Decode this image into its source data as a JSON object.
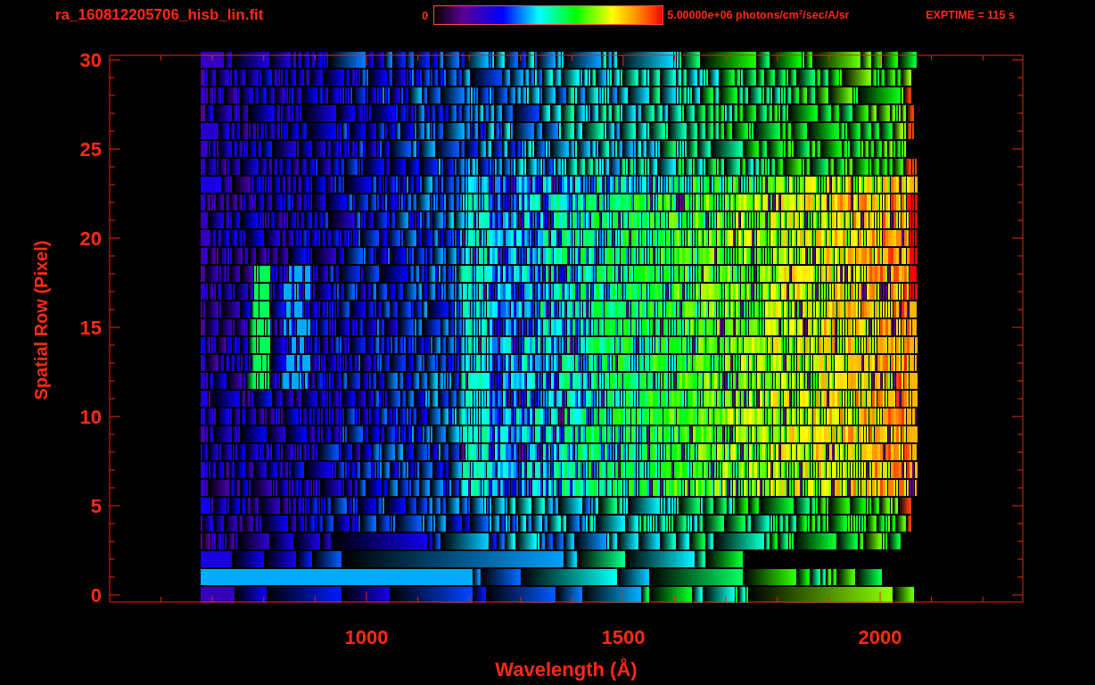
{
  "title": "ra_160812205706_hisb_lin.fit",
  "colorbar": {
    "min_label": "0",
    "max_label": "5.00000e+06 photons/cm$^{2}$/sec/A/sr"
  },
  "exposure": "EXPTIME = 115 s",
  "plot": {
    "xlabel": "Wavelength (Å)",
    "ylabel": "Spatial Row (Pixel)",
    "xticks": [
      "1000",
      "1500",
      "2000"
    ],
    "yticks": [
      "30",
      "25",
      "20",
      "15",
      "10",
      "5",
      "0"
    ]
  }
}
